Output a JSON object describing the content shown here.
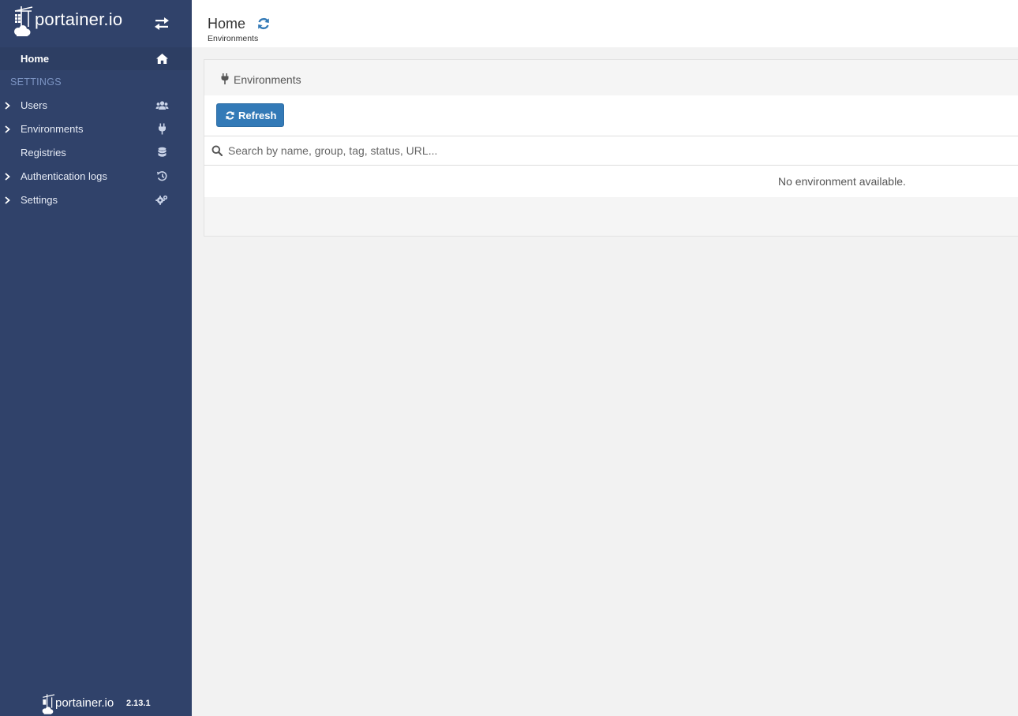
{
  "app": {
    "logo_text": "portainer.io",
    "version": "2.13.1",
    "accent_color": "#337ab7",
    "sidebar_color": "#30426a"
  },
  "sidebar": {
    "home": {
      "label": "Home",
      "icon": "home-icon"
    },
    "settings_heading": "SETTINGS",
    "items": [
      {
        "label": "Users",
        "icon": "users-icon",
        "expandable": true
      },
      {
        "label": "Environments",
        "icon": "plug-icon",
        "expandable": true
      },
      {
        "label": "Registries",
        "icon": "database-icon",
        "expandable": false
      },
      {
        "label": "Authentication logs",
        "icon": "history-icon",
        "expandable": true
      },
      {
        "label": "Settings",
        "icon": "cogs-icon",
        "expandable": true
      }
    ]
  },
  "header": {
    "title": "Home",
    "breadcrumb": "Environments"
  },
  "widget": {
    "title": "Environments",
    "refresh_label": "Refresh",
    "search_placeholder": "Search by name, group, tag, status, URL...",
    "search_value": "",
    "empty_message": "No environment available."
  }
}
